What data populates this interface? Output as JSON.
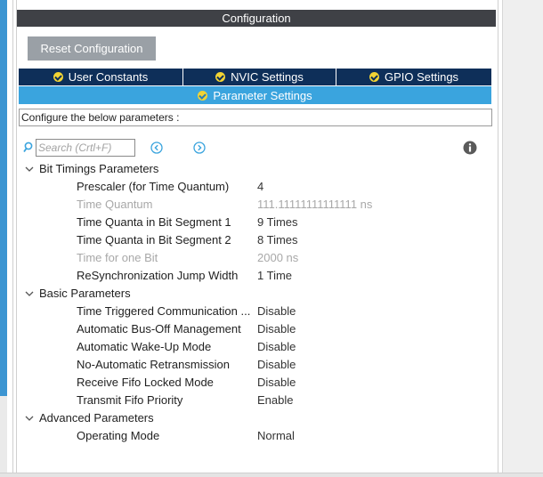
{
  "header": {
    "title": "Configuration"
  },
  "reset_button": {
    "label": "Reset Configuration"
  },
  "tabs": [
    {
      "label": "User Constants"
    },
    {
      "label": "NVIC Settings"
    },
    {
      "label": "GPIO Settings"
    }
  ],
  "active_tab": {
    "label": "Parameter Settings"
  },
  "description": "Configure the below parameters :",
  "search": {
    "placeholder": "Search (Crtl+F)",
    "value": ""
  },
  "groups": [
    {
      "label": "Bit Timings Parameters",
      "params": [
        {
          "label": "Prescaler (for Time Quantum)",
          "value": "4",
          "enabled": true
        },
        {
          "label": "Time Quantum",
          "value": "111.11111111111111 ns",
          "enabled": false
        },
        {
          "label": "Time Quanta in Bit Segment 1",
          "value": "9 Times",
          "enabled": true
        },
        {
          "label": "Time Quanta in Bit Segment 2",
          "value": "8 Times",
          "enabled": true
        },
        {
          "label": "Time for one Bit",
          "value": "2000 ns",
          "enabled": false
        },
        {
          "label": "ReSynchronization Jump Width",
          "value": "1 Time",
          "enabled": true
        }
      ]
    },
    {
      "label": "Basic Parameters",
      "params": [
        {
          "label": "Time Triggered Communication ...",
          "value": "Disable",
          "enabled": true
        },
        {
          "label": "Automatic Bus-Off Management",
          "value": "Disable",
          "enabled": true
        },
        {
          "label": "Automatic Wake-Up Mode",
          "value": "Disable",
          "enabled": true
        },
        {
          "label": "No-Automatic Retransmission",
          "value": "Disable",
          "enabled": true
        },
        {
          "label": "Receive Fifo Locked Mode",
          "value": "Disable",
          "enabled": true
        },
        {
          "label": "Transmit Fifo Priority",
          "value": "Enable",
          "enabled": true
        }
      ]
    },
    {
      "label": "Advanced Parameters",
      "params": [
        {
          "label": "Operating Mode",
          "value": "Normal",
          "enabled": true
        }
      ]
    }
  ],
  "colors": {
    "header_bg": "#3f4146",
    "tab_bg": "#0e2f59",
    "active_tab_bg": "#3aa4de",
    "check": "#f2d434",
    "disabled_text": "#a8a8a8"
  },
  "icons": {
    "search": "search-icon",
    "prev": "arrow-left-circle-icon",
    "next": "arrow-right-circle-icon",
    "info": "info-icon",
    "expanded": "chevron-down-icon",
    "tab_status": "check-circle-icon"
  }
}
